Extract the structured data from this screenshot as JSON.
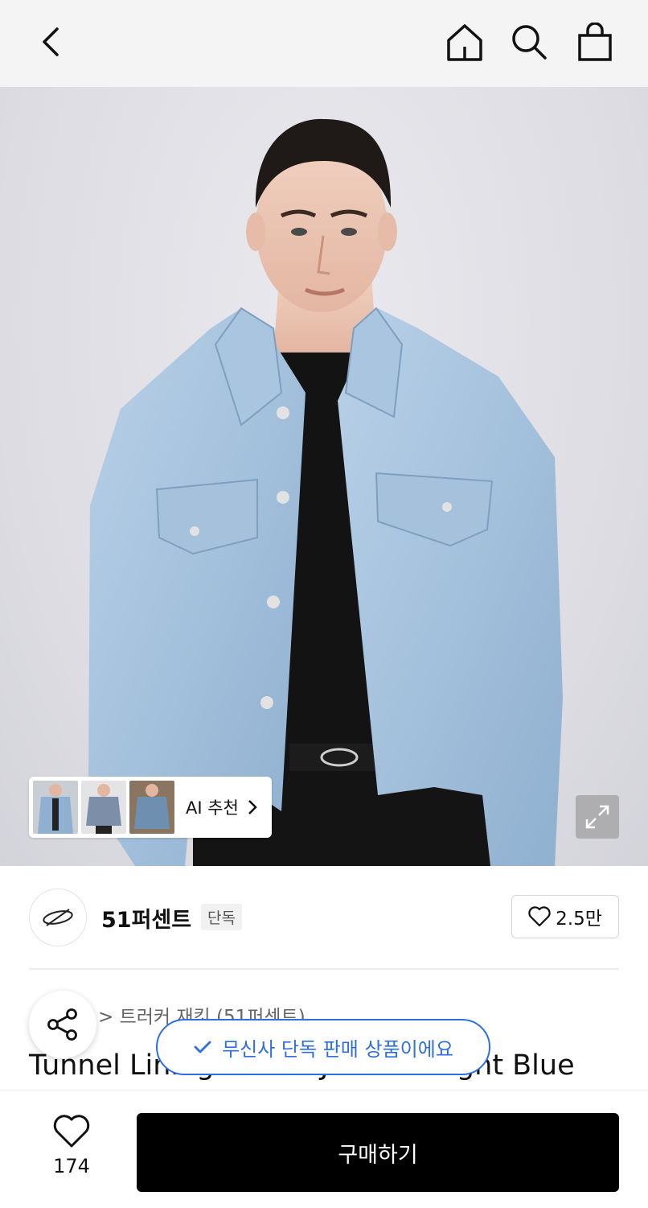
{
  "header": {
    "icons": [
      "chevron-left-icon",
      "home-icon",
      "search-icon",
      "shopping-bag-icon"
    ]
  },
  "hero": {
    "ai_recommend_label": "AI 추천",
    "thumbnails": [
      "denim-jacket-front",
      "denim-jacket-grey",
      "denim-jacket-side"
    ]
  },
  "brand": {
    "name": "51퍼센트",
    "badge": "단독",
    "likes": "2.5만"
  },
  "product": {
    "breadcrumb": "> 트러커 재킷 (51퍼센트)",
    "title": "Tunnel Lining denim Jacket - Light Blue"
  },
  "toast": {
    "text": "무신사 단독 판매 상품이에요"
  },
  "bottom": {
    "wish_count": "174",
    "buy_label": "구매하기"
  },
  "colors": {
    "accent_blue": "#2f6ee0",
    "buy_button": "#000000",
    "denim": "#9fbfdc"
  }
}
